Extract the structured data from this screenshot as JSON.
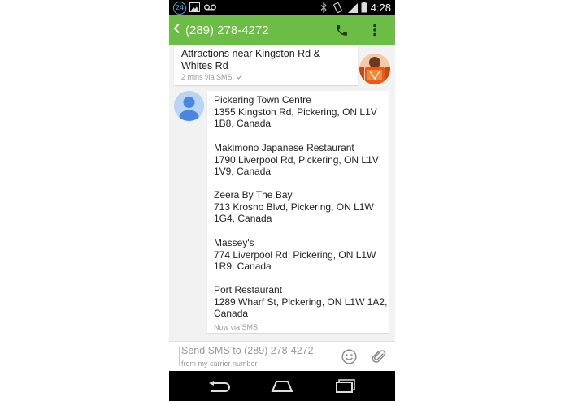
{
  "status_bar": {
    "notification_badge": "24",
    "time": "4:28",
    "icons": [
      "image-icon",
      "voicemail-icon",
      "bluetooth-icon",
      "vibrate-icon",
      "signal-icon",
      "battery-icon"
    ]
  },
  "action_bar": {
    "title": "(289) 278-4272",
    "icons": [
      "back-icon",
      "phone-icon",
      "overflow-menu-icon"
    ],
    "accent_color": "#6bbd45"
  },
  "messages": [
    {
      "direction": "outgoing",
      "text": "Attractions near Kingston Rd & Whites Rd",
      "meta": "2 mins via SMS"
    },
    {
      "direction": "incoming",
      "places": [
        {
          "name": "Pickering Town Centre",
          "address": "1355 Kingston Rd, Pickering, ON L1V 1B8, Canada"
        },
        {
          "name": "Makimono Japanese Restaurant",
          "address": "1790 Liverpool Rd, Pickering, ON L1V 1V9, Canada"
        },
        {
          "name": "Zeera By The Bay",
          "address": "713 Krosno Blvd, Pickering, ON L1W 1G4, Canada"
        },
        {
          "name": "Massey's",
          "address": "774 Liverpool Rd, Pickering, ON L1W 1R9, Canada"
        },
        {
          "name": "Port Restaurant",
          "address": "1289 Wharf St, Pickering, ON L1W 1A2, Canada"
        }
      ],
      "meta": "Now via SMS"
    }
  ],
  "compose": {
    "placeholder": "Send SMS to (289) 278-4272",
    "subtext": "from my carrier number"
  },
  "nav_bar": {
    "icons": [
      "back-nav-icon",
      "home-nav-icon",
      "recents-nav-icon"
    ]
  }
}
